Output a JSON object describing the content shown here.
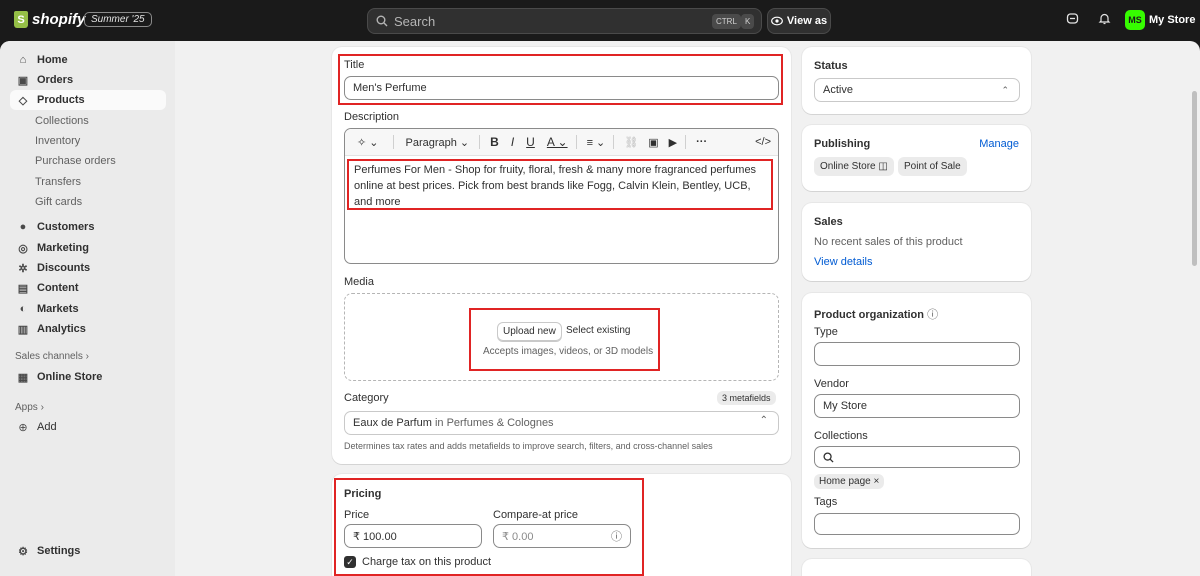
{
  "topbar": {
    "logo_text": "shopify",
    "edition_badge": "Summer '25",
    "search_placeholder": "Search",
    "kbd_ctrl": "CTRL",
    "kbd_k": "K",
    "view_as_label": "View as",
    "avatar_initials": "MS",
    "store_name": "My Store"
  },
  "sidebar": {
    "items": [
      {
        "label": "Home",
        "icon": "home-icon"
      },
      {
        "label": "Orders",
        "icon": "inbox-icon"
      },
      {
        "label": "Products",
        "icon": "tag-icon"
      },
      {
        "label": "Customers",
        "icon": "person-icon"
      },
      {
        "label": "Marketing",
        "icon": "target-icon"
      },
      {
        "label": "Discounts",
        "icon": "discount-icon"
      },
      {
        "label": "Content",
        "icon": "content-icon"
      },
      {
        "label": "Markets",
        "icon": "globe-icon"
      },
      {
        "label": "Analytics",
        "icon": "bar-chart-icon"
      }
    ],
    "product_subitems": [
      "Collections",
      "Inventory",
      "Purchase orders",
      "Transfers",
      "Gift cards"
    ],
    "sales_channels_label": "Sales channels",
    "online_store_label": "Online Store",
    "apps_label": "Apps",
    "add_label": "Add",
    "settings_label": "Settings"
  },
  "product": {
    "title_label": "Title",
    "title_value": "Men's Perfume",
    "description_label": "Description",
    "editor_paragraph": "Paragraph",
    "description_text": "Perfumes For Men - Shop for fruity, floral, fresh & many more fragranced perfumes online at best prices. Pick from best brands like Fogg, Calvin Klein, Bentley, UCB, and more",
    "media_label": "Media",
    "upload_new": "Upload new",
    "select_existing": "Select existing",
    "media_hint": "Accepts images, videos, or 3D models",
    "category_label": "Category",
    "metafields_badge": "3 metafields",
    "category_value": "Eaux de Parfum",
    "category_in": "in",
    "category_path": "Perfumes & Colognes",
    "category_hint": "Determines tax rates and adds metafields to improve search, filters, and cross-channel sales"
  },
  "pricing": {
    "heading": "Pricing",
    "price_label": "Price",
    "price_value": "₹ 100.00",
    "compare_label": "Compare-at price",
    "compare_placeholder": "₹ 0.00",
    "charge_tax_label": "Charge tax on this product",
    "charge_tax_checked": true
  },
  "status": {
    "heading": "Status",
    "value": "Active"
  },
  "publishing": {
    "heading": "Publishing",
    "manage": "Manage",
    "channels": [
      "Online Store",
      "Point of Sale"
    ]
  },
  "sales": {
    "heading": "Sales",
    "text": "No recent sales of this product",
    "link": "View details"
  },
  "organization": {
    "heading": "Product organization",
    "type_label": "Type",
    "type_value": "",
    "vendor_label": "Vendor",
    "vendor_value": "My Store",
    "collections_label": "Collections",
    "collection_tag": "Home page",
    "tags_label": "Tags"
  },
  "colors": {
    "highlight_red": "#e02424",
    "link_blue": "#005bd3",
    "avatar_green": "#36fc00"
  }
}
